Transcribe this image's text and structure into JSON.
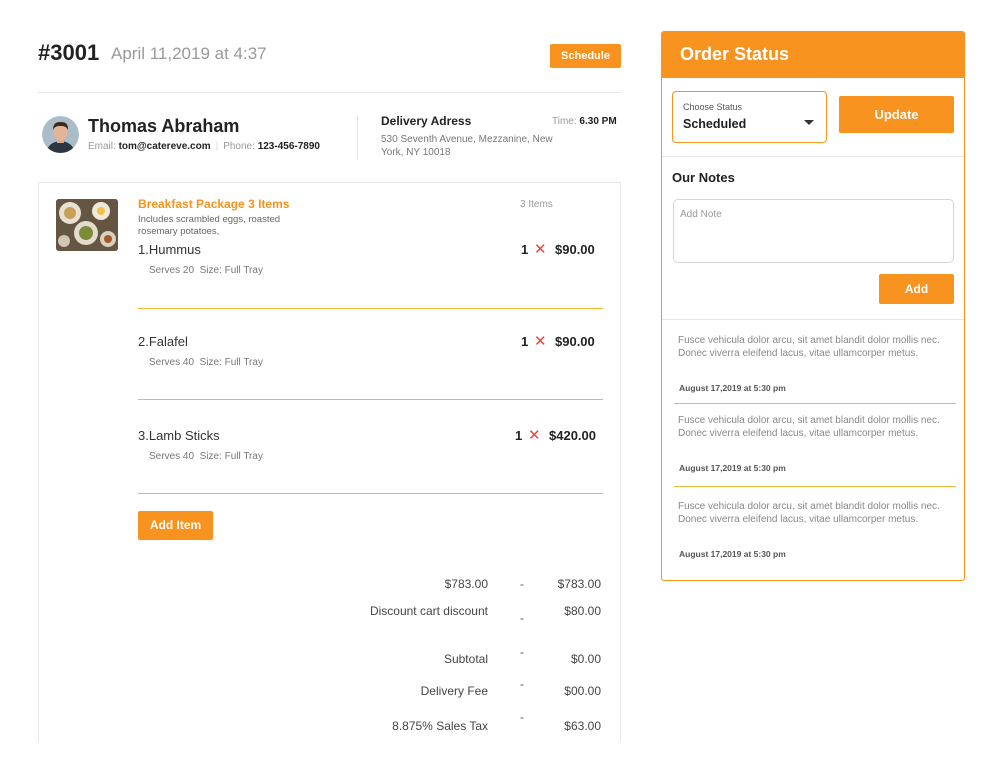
{
  "order": {
    "number": "#3001",
    "date": "April 11,2019 at 4:37",
    "schedule_label": "Schedule"
  },
  "customer": {
    "name": "Thomas Abraham",
    "email_label": "Email:",
    "email": "tom@catereve.com",
    "phone_label": "Phone:",
    "phone": "123-456-7890"
  },
  "delivery": {
    "label": "Delivery Adress",
    "address": "530 Seventh Avenue, Mezzanine, New York, NY 10018",
    "time_label": "Time:",
    "time": "6.30 PM"
  },
  "package": {
    "title": "Breakfast Package 3 Items",
    "description": "Includes scrambled eggs, roasted rosemary potatoes,",
    "count": "3 Items"
  },
  "items": [
    {
      "name": "1.Hummus",
      "serves": "Serves 20",
      "size": "Size: Full Tray",
      "qty": "1",
      "x": "✕",
      "price": "$90.00"
    },
    {
      "name": "2.Falafel",
      "serves": "Serves 40",
      "size": "Size: Full Tray",
      "qty": "1",
      "x": "✕",
      "price": "$90.00"
    },
    {
      "name": "3.Lamb Sticks",
      "serves": "Serves 40",
      "size": "Size: Full Tray",
      "qty": "1",
      "x": "✕",
      "price": "$420.00"
    }
  ],
  "add_item_label": "Add Item",
  "totals": [
    {
      "label": "$783.00",
      "dash": "-",
      "value": "$783.00"
    },
    {
      "label": "Discount cart discount",
      "dash": "-",
      "value": "$80.00"
    },
    {
      "label": "Subtotal",
      "dash": "-",
      "value": "$0.00"
    },
    {
      "label": "Delivery Fee",
      "dash": "-",
      "value": "$00.00"
    },
    {
      "label": "8.875% Sales Tax",
      "dash": "-",
      "value": "$63.00"
    }
  ],
  "status_panel": {
    "title": "Order Status",
    "select_label": "Choose Status",
    "select_value": "Scheduled",
    "update_label": "Update",
    "notes_title": "Our Notes",
    "note_placeholder": "Add Note",
    "add_label": "Add",
    "notes": [
      {
        "text": "Fusce vehicula dolor arcu, sit amet blandit dolor mollis nec. Donec viverra eleifend lacus, vitae ullamcorper metus.",
        "date": "August 17,2019 at 5:30 pm"
      },
      {
        "text": "Fusce vehicula dolor arcu, sit amet blandit dolor mollis nec. Donec viverra eleifend lacus, vitae ullamcorper metus.",
        "date": "August 17,2019 at 5:30 pm"
      },
      {
        "text": "Fusce vehicula dolor arcu, sit amet blandit dolor mollis nec. Donec viverra eleifend lacus, vitae ullamcorper metus.",
        "date": "August 17,2019 at 5:30 pm"
      }
    ]
  },
  "colors": {
    "accent": "#f7931e",
    "divider": "#f5b43a",
    "remove": "#e8463a"
  },
  "icons": {
    "avatar": "user-avatar",
    "food": "food-thumbnail",
    "caret": "chevron-down-icon",
    "remove": "close-icon"
  }
}
